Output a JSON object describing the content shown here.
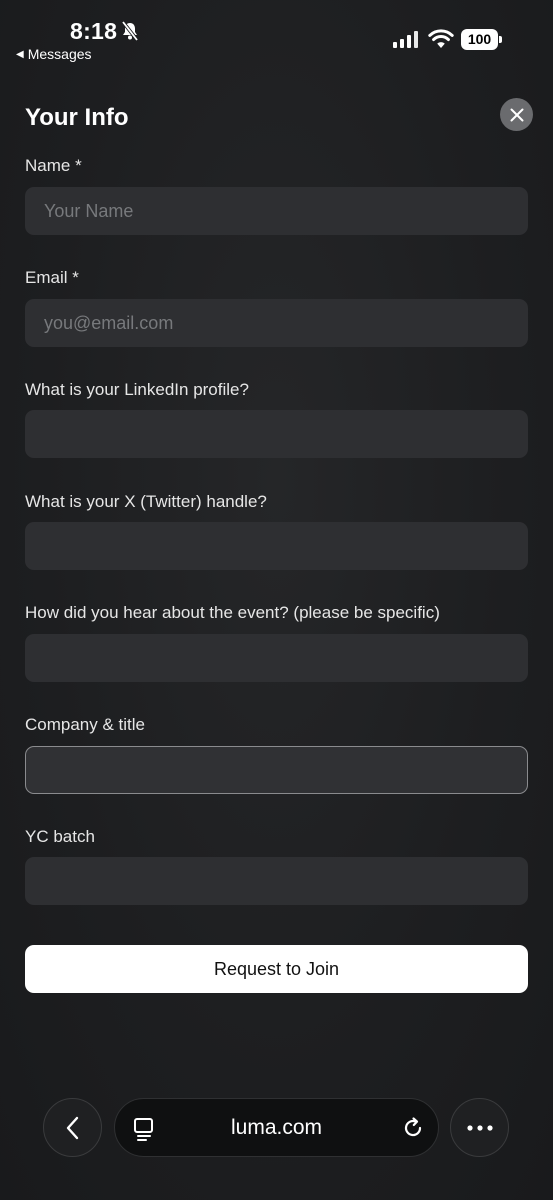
{
  "status_bar": {
    "time": "8:18",
    "back_app": "Messages",
    "battery": "100"
  },
  "form": {
    "title": "Your Info",
    "fields": [
      {
        "label": "Name *",
        "placeholder": "Your Name",
        "value": ""
      },
      {
        "label": "Email *",
        "placeholder": "you@email.com",
        "value": ""
      },
      {
        "label": "What is your LinkedIn profile?",
        "placeholder": "",
        "value": ""
      },
      {
        "label": "What is your X (Twitter) handle?",
        "placeholder": "",
        "value": ""
      },
      {
        "label": "How did you hear about the event? (please be specific)",
        "placeholder": "",
        "value": ""
      },
      {
        "label": "Company & title",
        "placeholder": "",
        "value": ""
      },
      {
        "label": "YC batch",
        "placeholder": "",
        "value": ""
      }
    ],
    "submit_label": "Request to Join"
  },
  "browser": {
    "url": "luma.com"
  },
  "icons": {
    "bell_muted": "bell-slash-icon",
    "close": "close-icon",
    "back": "chevron-left-icon",
    "tabs": "tabs-icon",
    "reload": "reload-icon",
    "more": "more-icon"
  }
}
